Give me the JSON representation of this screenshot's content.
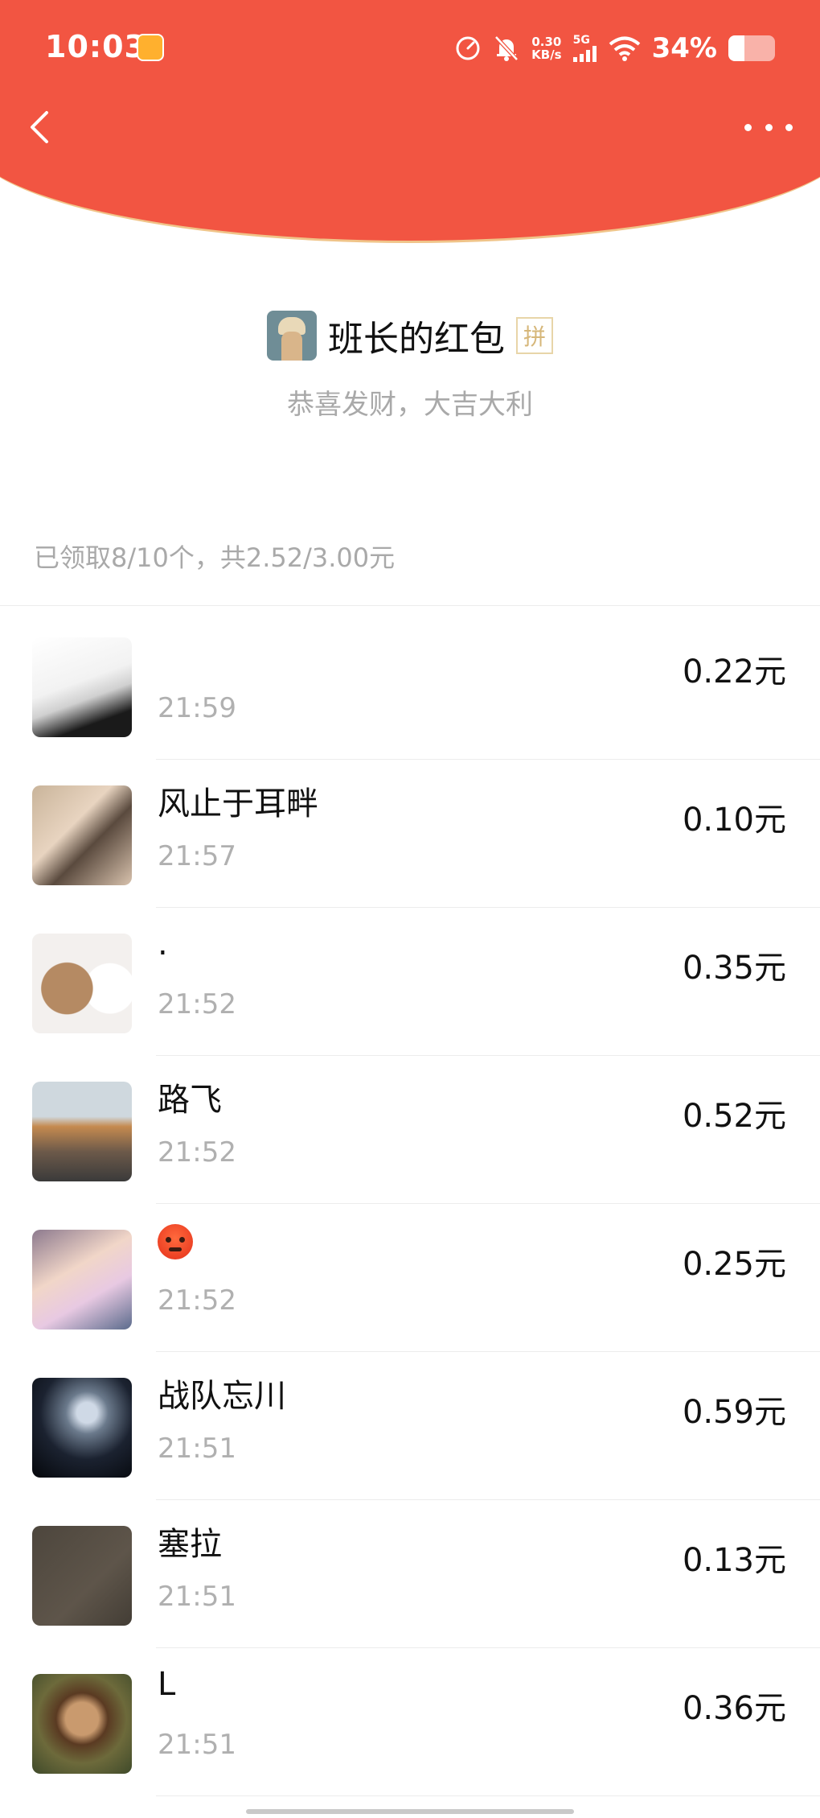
{
  "status_bar": {
    "time": "10:03",
    "net_speed_value": "0.30",
    "net_speed_unit": "KB/s",
    "network": "5G",
    "battery_percent": "34%",
    "battery_level": 0.34
  },
  "sender": {
    "name": "班长的红包",
    "badge": "拼",
    "blessing": "恭喜发财，大吉大利"
  },
  "summary": "已领取8/10个，共2.52/3.00元",
  "colors": {
    "header_red": "#f25542",
    "header_border": "#f0c489",
    "muted_text": "#a9a9a9"
  },
  "recipients": [
    {
      "name": "",
      "time": "21:59",
      "amount": "0.22元"
    },
    {
      "name": "风止于耳畔",
      "time": "21:57",
      "amount": "0.10元"
    },
    {
      "name": ".",
      "time": "21:52",
      "amount": "0.35元"
    },
    {
      "name": "路飞",
      "time": "21:52",
      "amount": "0.52元"
    },
    {
      "name": "",
      "name_icon": "angry-face-emoji",
      "time": "21:52",
      "amount": "0.25元"
    },
    {
      "name": "战队忘川",
      "time": "21:51",
      "amount": "0.59元"
    },
    {
      "name": "塞拉",
      "time": "21:51",
      "amount": "0.13元"
    },
    {
      "name": "L",
      "time": "21:51",
      "amount": "0.36元"
    }
  ]
}
